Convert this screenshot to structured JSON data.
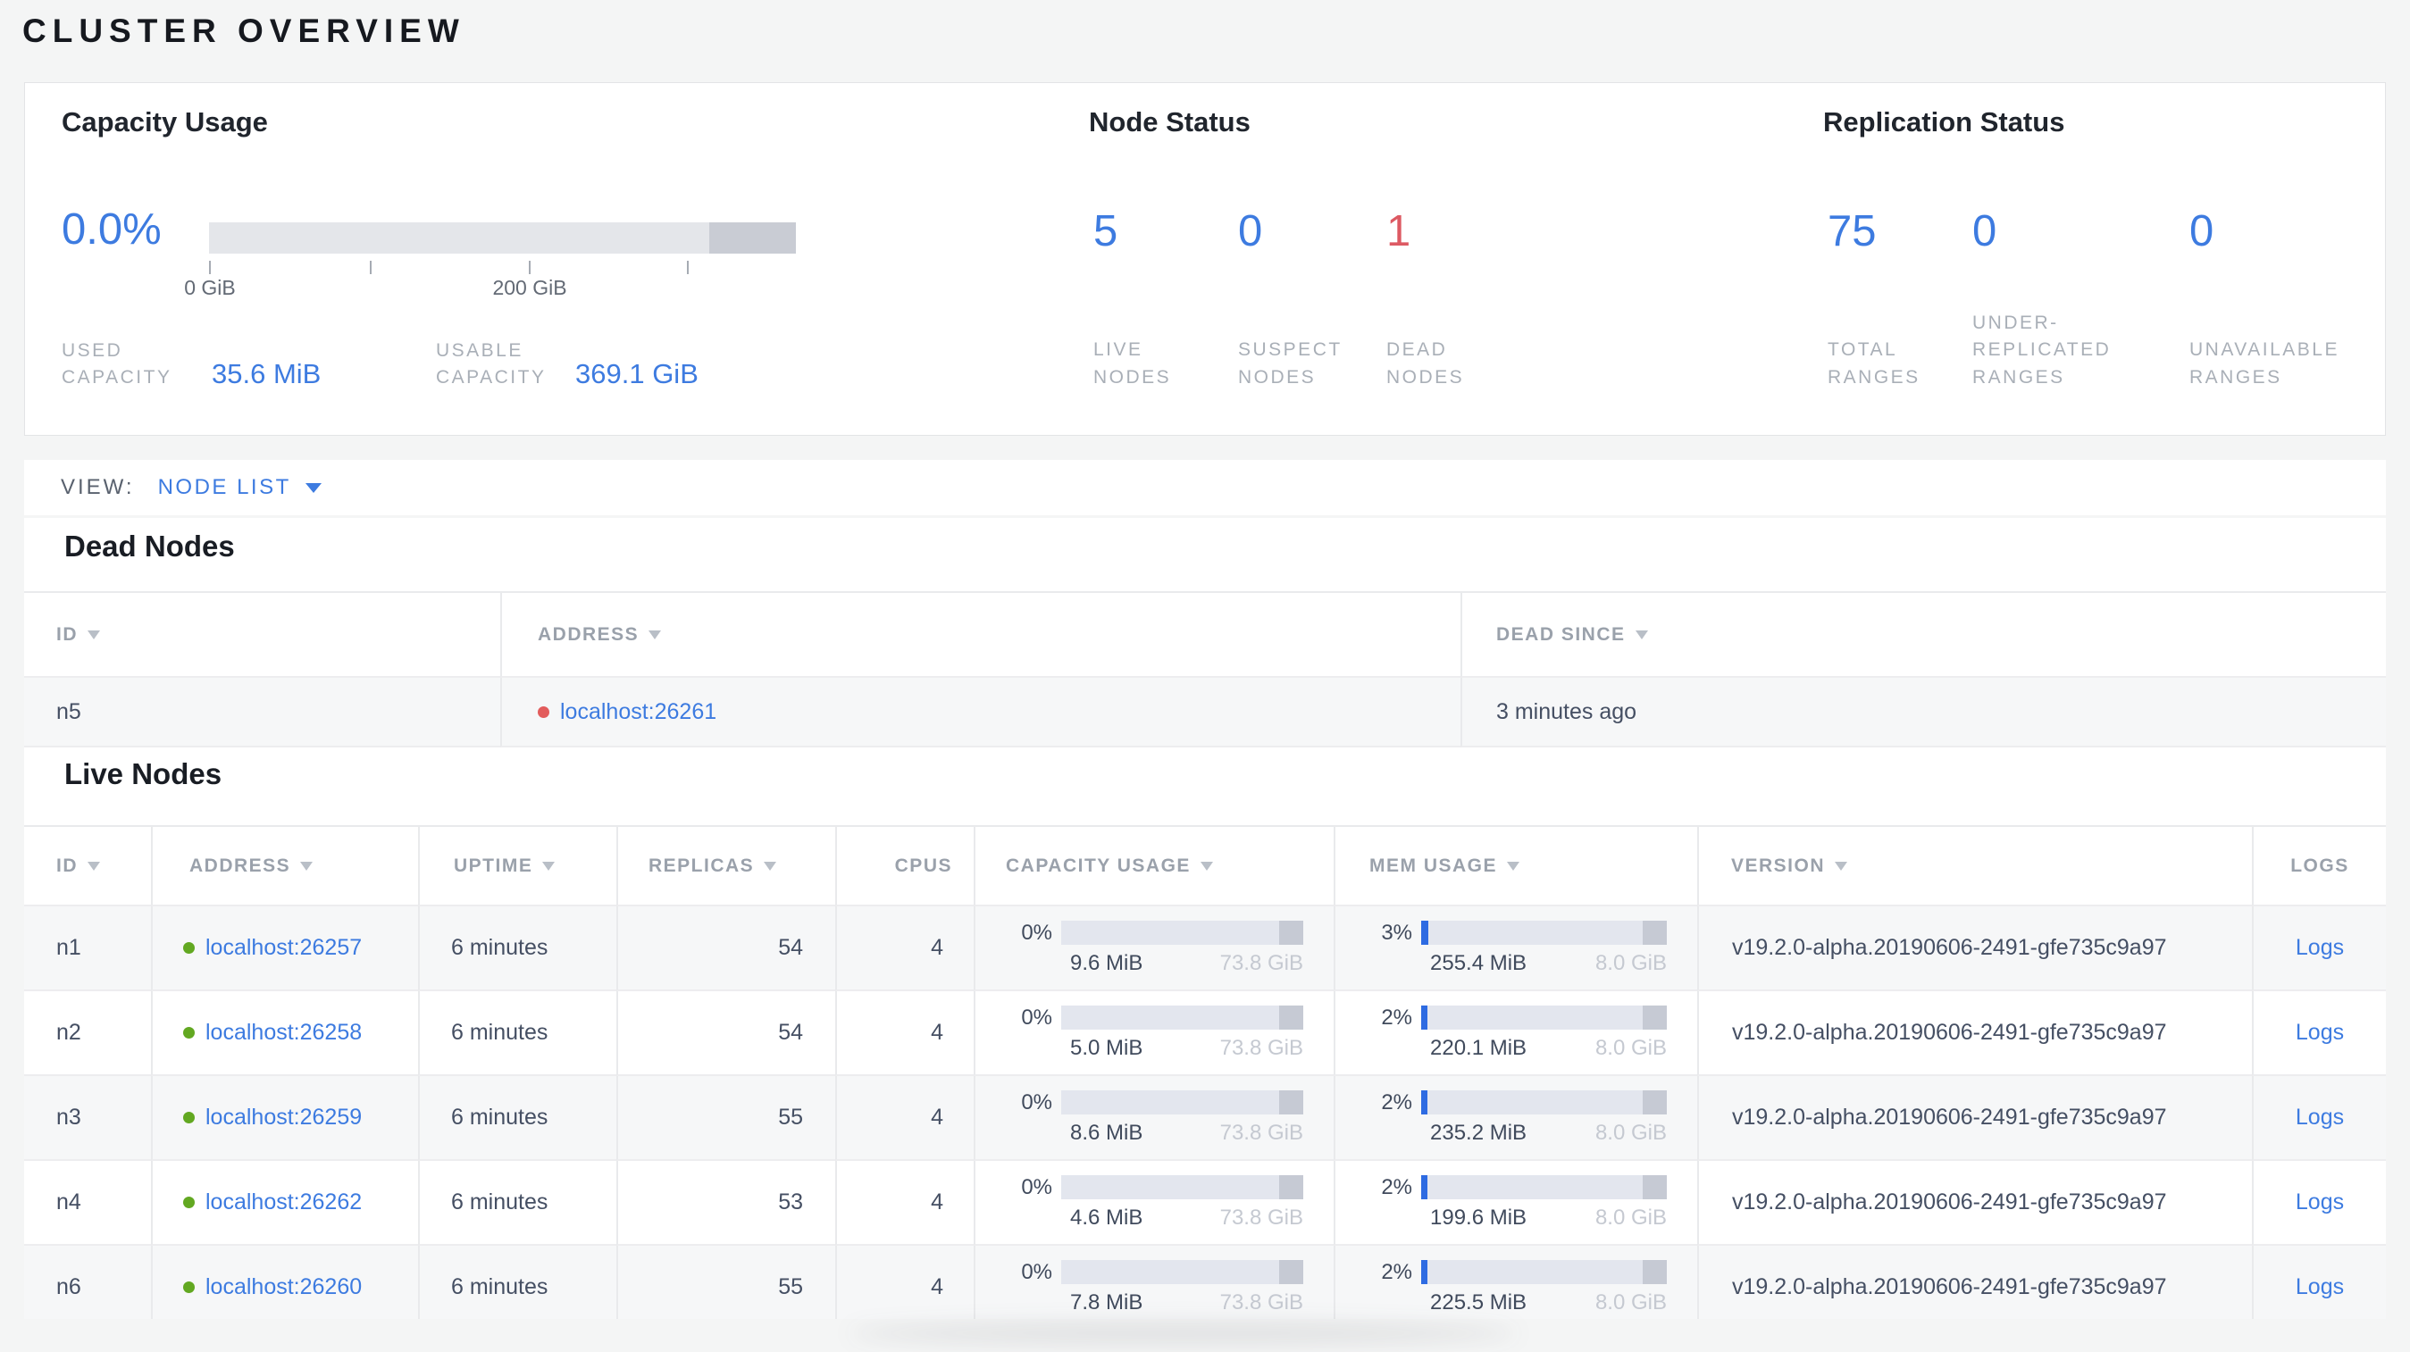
{
  "page_title": "CLUSTER OVERVIEW",
  "colors": {
    "accent_blue": "#3d7be0",
    "danger_red": "#dd5a63",
    "live_green": "#62a821",
    "dead_red": "#e25c5c"
  },
  "summary": {
    "capacity": {
      "title": "Capacity Usage",
      "percent_label": "0.0%",
      "used_fill_pct": 0,
      "axis_labels": {
        "zero": "0 GiB",
        "twohundred": "200 GiB"
      },
      "stats": [
        {
          "label": "USED CAPACITY",
          "value": "35.6 MiB"
        },
        {
          "label": "USABLE CAPACITY",
          "value": "369.1 GiB"
        }
      ]
    },
    "node_status": {
      "title": "Node Status",
      "stats": [
        {
          "value": "5",
          "label": "LIVE NODES"
        },
        {
          "value": "0",
          "label": "SUSPECT NODES"
        },
        {
          "value": "1",
          "label": "DEAD NODES"
        }
      ]
    },
    "replication": {
      "title": "Replication Status",
      "stats": [
        {
          "value": "75",
          "label": "TOTAL RANGES"
        },
        {
          "value": "0",
          "label": "UNDER-REPLICATED RANGES"
        },
        {
          "value": "0",
          "label": "UNAVAILABLE RANGES"
        }
      ]
    }
  },
  "view_bar": {
    "label": "VIEW:",
    "selected": "NODE LIST"
  },
  "dead_nodes": {
    "heading": "Dead Nodes",
    "columns": {
      "id": "ID",
      "address": "ADDRESS",
      "dead_since": "DEAD SINCE"
    },
    "rows": [
      {
        "id": "n5",
        "address": "localhost:26261",
        "dead_since": "3 minutes ago"
      }
    ]
  },
  "live_nodes": {
    "heading": "Live Nodes",
    "columns": {
      "id": "ID",
      "address": "ADDRESS",
      "uptime": "UPTIME",
      "replicas": "REPLICAS",
      "cpus": "CPUS",
      "capacity": "CAPACITY USAGE",
      "mem": "MEM USAGE",
      "version": "VERSION",
      "logs": "LOGS"
    },
    "logs_label": "Logs",
    "rows": [
      {
        "id": "n1",
        "address": "localhost:26257",
        "uptime": "6 minutes",
        "replicas": "54",
        "cpus": "4",
        "cap_pct": "0%",
        "cap_fill": 0,
        "cap_used": "9.6 MiB",
        "cap_total": "73.8 GiB",
        "mem_pct": "3%",
        "mem_fill": 3,
        "mem_used": "255.4 MiB",
        "mem_total": "8.0 GiB",
        "version": "v19.2.0-alpha.20190606-2491-gfe735c9a97"
      },
      {
        "id": "n2",
        "address": "localhost:26258",
        "uptime": "6 minutes",
        "replicas": "54",
        "cpus": "4",
        "cap_pct": "0%",
        "cap_fill": 0,
        "cap_used": "5.0 MiB",
        "cap_total": "73.8 GiB",
        "mem_pct": "2%",
        "mem_fill": 2.5,
        "mem_used": "220.1 MiB",
        "mem_total": "8.0 GiB",
        "version": "v19.2.0-alpha.20190606-2491-gfe735c9a97"
      },
      {
        "id": "n3",
        "address": "localhost:26259",
        "uptime": "6 minutes",
        "replicas": "55",
        "cpus": "4",
        "cap_pct": "0%",
        "cap_fill": 0,
        "cap_used": "8.6 MiB",
        "cap_total": "73.8 GiB",
        "mem_pct": "2%",
        "mem_fill": 2.5,
        "mem_used": "235.2 MiB",
        "mem_total": "8.0 GiB",
        "version": "v19.2.0-alpha.20190606-2491-gfe735c9a97"
      },
      {
        "id": "n4",
        "address": "localhost:26262",
        "uptime": "6 minutes",
        "replicas": "53",
        "cpus": "4",
        "cap_pct": "0%",
        "cap_fill": 0,
        "cap_used": "4.6 MiB",
        "cap_total": "73.8 GiB",
        "mem_pct": "2%",
        "mem_fill": 2.5,
        "mem_used": "199.6 MiB",
        "mem_total": "8.0 GiB",
        "version": "v19.2.0-alpha.20190606-2491-gfe735c9a97"
      },
      {
        "id": "n6",
        "address": "localhost:26260",
        "uptime": "6 minutes",
        "replicas": "55",
        "cpus": "4",
        "cap_pct": "0%",
        "cap_fill": 0,
        "cap_used": "7.8 MiB",
        "cap_total": "73.8 GiB",
        "mem_pct": "2%",
        "mem_fill": 2.5,
        "mem_used": "225.5 MiB",
        "mem_total": "8.0 GiB",
        "version": "v19.2.0-alpha.20190606-2491-gfe735c9a97"
      }
    ]
  }
}
